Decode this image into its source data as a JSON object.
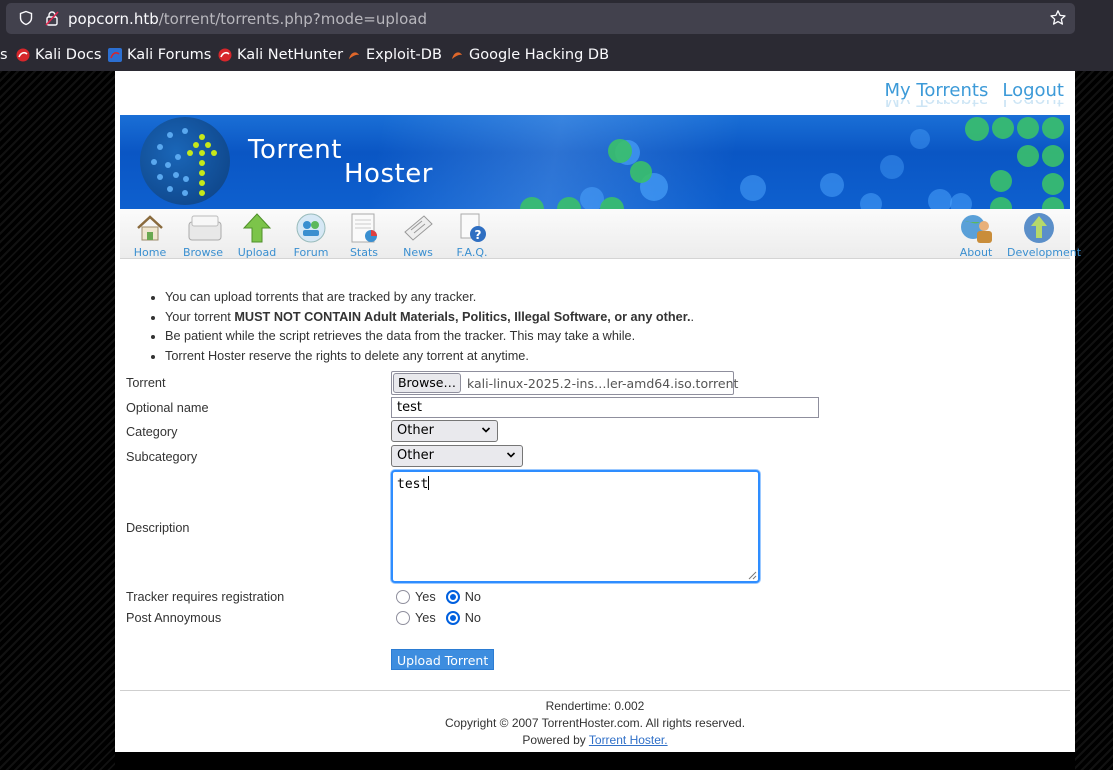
{
  "browser": {
    "url_host": "popcorn.htb",
    "url_path": "/torrent/torrents.php?mode=upload",
    "bookmarks": [
      {
        "label": "Kali Docs",
        "icon": "kali-docs-icon"
      },
      {
        "label": "Kali Forums",
        "icon": "kali-forums-icon"
      },
      {
        "label": "Kali NetHunter",
        "icon": "kali-nethunter-icon"
      },
      {
        "label": "Exploit-DB",
        "icon": "exploit-db-icon"
      },
      {
        "label": "Google Hacking DB",
        "icon": "ghdb-icon"
      }
    ],
    "bookmark_prefix": "s"
  },
  "header": {
    "my_torrents": "My Torrents",
    "logout": "Logout"
  },
  "banner": {
    "title_line1": "Torrent",
    "title_line2": "Hoster"
  },
  "nav": {
    "left": [
      {
        "label": "Home",
        "icon": "home-icon"
      },
      {
        "label": "Browse",
        "icon": "browse-icon"
      },
      {
        "label": "Upload",
        "icon": "upload-icon"
      },
      {
        "label": "Forum",
        "icon": "forum-icon"
      },
      {
        "label": "Stats",
        "icon": "stats-icon"
      },
      {
        "label": "News",
        "icon": "news-icon"
      },
      {
        "label": "F.A.Q.",
        "icon": "faq-icon"
      }
    ],
    "right": [
      {
        "label": "About",
        "icon": "about-icon"
      },
      {
        "label": "Development",
        "icon": "development-icon"
      }
    ]
  },
  "rules": {
    "r1": "You can upload torrents that are tracked by any tracker.",
    "r2_pre": "Your torrent ",
    "r2_bold": "MUST NOT CONTAIN Adult Materials, Politics, Illegal Software, or any other.",
    "r2_post": ".",
    "r3": "Be patient while the script retrieves the data from the tracker. This may take a while.",
    "r4": "Torrent Hoster reserve the rights to delete any torrent at anytime."
  },
  "form": {
    "torrent_label": "Torrent",
    "browse_label": "Browse…",
    "file_name": "kali-linux-2025.2-ins…ler-amd64.iso.torrent",
    "optional_name_label": "Optional name",
    "optional_name_value": "test",
    "category_label": "Category",
    "category_value": "Other",
    "subcategory_label": "Subcategory",
    "subcategory_value": "Other",
    "description_label": "Description",
    "description_value": "test",
    "tracker_reg_label": "Tracker requires registration",
    "post_anon_label": "Post Annoymous",
    "yes": "Yes",
    "no": "No",
    "tracker_reg_selected": "No",
    "post_anon_selected": "No",
    "submit_label": "Upload Torrent"
  },
  "footer": {
    "rendertime": "Rendertime: 0.002",
    "copyright": "Copyright © 2007 TorrentHoster.com. All rights reserved.",
    "powered_pre": "Powered by ",
    "powered_link": "Torrent Hoster."
  },
  "colors": {
    "link": "#3c9ad8",
    "banner": "#0a56c4",
    "focus": "#2e8dff",
    "button": "#3d8ddf"
  }
}
